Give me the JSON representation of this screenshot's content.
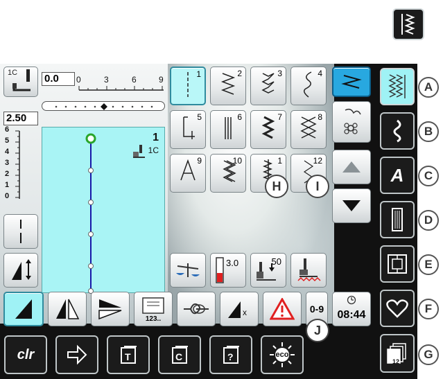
{
  "top_icon": {
    "name": "zigzag-stitch-icon"
  },
  "left_panel": {
    "needle_position": "1C",
    "stitch_width_value": "0.0",
    "width_scale": [
      "0",
      "3",
      "6",
      "9"
    ],
    "stitch_length_value": "2.50",
    "length_scale": [
      "6",
      "5",
      "4",
      "3",
      "2",
      "1",
      "0"
    ],
    "preview_number": "1",
    "preview_foot": "1C"
  },
  "stitch_grid": [
    {
      "n": "1"
    },
    {
      "n": "2"
    },
    {
      "n": "3"
    },
    {
      "n": "4"
    },
    {
      "n": "5"
    },
    {
      "n": "6"
    },
    {
      "n": "7"
    },
    {
      "n": "8"
    },
    {
      "n": "9"
    },
    {
      "n": "10"
    },
    {
      "n": "1"
    },
    {
      "n": "12"
    }
  ],
  "function_row": {
    "tension_value": "3.0",
    "presser_pressure": "50"
  },
  "bottom_row": {
    "clr_label": "clr",
    "numeric_label": "0-9",
    "time": "08:44",
    "counter_label": "123..",
    "eco_label": "eco"
  },
  "callouts": {
    "A": "A",
    "B": "B",
    "C": "C",
    "D": "D",
    "E": "E",
    "F": "F",
    "G": "G",
    "H": "H",
    "I": "I",
    "J": "J"
  },
  "side_menu": {
    "pages_count": "12"
  },
  "colors": {
    "selected_bg": "#9ff2f5",
    "screen_dark": "#111111",
    "warning_red": "#e02020"
  }
}
